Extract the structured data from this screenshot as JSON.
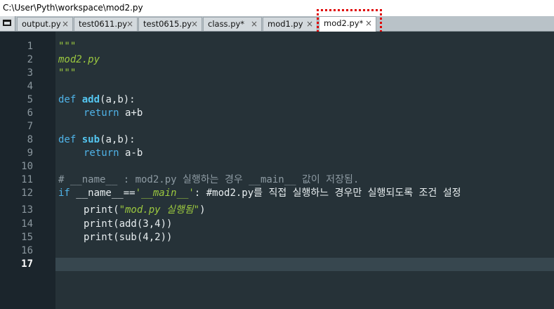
{
  "window": {
    "title": "C:\\User\\Pyth\\workspace\\mod2.py"
  },
  "tabs": [
    {
      "label": "output.py",
      "close": "×"
    },
    {
      "label": "test0611.py",
      "close": "×"
    },
    {
      "label": "test0615.py",
      "close": "×"
    },
    {
      "label": "class.py*",
      "close": "×"
    },
    {
      "label": "mod1.py",
      "close": "×"
    },
    {
      "label": "mod2.py*",
      "close": "×"
    }
  ],
  "active_tab_index": 5,
  "colors": {
    "editor_bg": "#263238",
    "gutter_bg": "#1b252c",
    "current_line_bg": "#37474f",
    "keyword": "#4fb3e8",
    "function_name": "#54c6f0",
    "string_docstring": "#9cc93f",
    "comment": "#8d9aa2",
    "highlight_box": "#e00000"
  },
  "current_line": 17,
  "line_numbers": [
    "1",
    "2",
    "3",
    "4",
    "5",
    "6",
    "7",
    "8",
    "9",
    "10",
    "11",
    "12",
    "13",
    "14",
    "15",
    "16",
    "17"
  ],
  "code": {
    "l1": "\"\"\"",
    "l2": "mod2.py",
    "l3": "\"\"\"",
    "l5_def": "def",
    "l5_name": "add",
    "l5_rest": "(a,b):",
    "l6_kw": "return",
    "l6_rest": " a+b",
    "l8_def": "def",
    "l8_name": "sub",
    "l8_rest": "(a,b):",
    "l9_kw": "return",
    "l9_rest": " a-b",
    "l11": "# __name__ : mod2.py 실행하는 경우 __main__ 값이 저장됨.",
    "l12_kw": "if",
    "l12_a": " __name__==",
    "l12_str": "'__main__'",
    "l12_b": ": #mod2.py를 직접 실행하느 경우만 실행되도록 조건 설정",
    "l13_a": "print(",
    "l13_str": "\"mod.py 실행됨\"",
    "l13_b": ")",
    "l14": "print(add(3,4))",
    "l15": "print(sub(4,2))"
  }
}
